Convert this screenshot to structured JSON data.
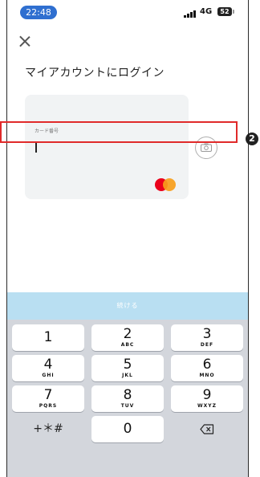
{
  "status_bar": {
    "time": "22:48",
    "network": "4G",
    "battery": "52"
  },
  "header": {
    "title": "マイアカウントにログイン"
  },
  "card": {
    "field_label": "カード番号",
    "brand": "mastercard"
  },
  "actions": {
    "continue_label": "続ける"
  },
  "keyboard": {
    "keys": [
      {
        "digit": "1",
        "letters": ""
      },
      {
        "digit": "2",
        "letters": "ABC"
      },
      {
        "digit": "3",
        "letters": "DEF"
      },
      {
        "digit": "4",
        "letters": "GHI"
      },
      {
        "digit": "5",
        "letters": "JKL"
      },
      {
        "digit": "6",
        "letters": "MNO"
      },
      {
        "digit": "7",
        "letters": "PQRS"
      },
      {
        "digit": "8",
        "letters": "TUV"
      },
      {
        "digit": "9",
        "letters": "WXYZ"
      },
      {
        "digit": "0",
        "letters": ""
      }
    ],
    "symbols_label": "+＊#",
    "delete_icon": "backspace-icon"
  },
  "annotation": {
    "badge": "2"
  },
  "colors": {
    "accent": "#2f6fd0",
    "continue_bg": "#b9dff2",
    "highlight": "#e02a2a"
  }
}
